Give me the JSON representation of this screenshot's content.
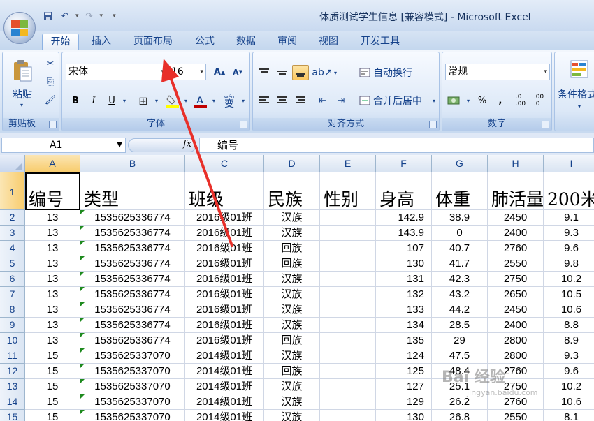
{
  "window": {
    "title": "体质测试学生信息  [兼容模式] - Microsoft Excel"
  },
  "tabs": [
    {
      "label": "开始",
      "active": true
    },
    {
      "label": "插入"
    },
    {
      "label": "页面布局"
    },
    {
      "label": "公式"
    },
    {
      "label": "数据"
    },
    {
      "label": "审阅"
    },
    {
      "label": "视图"
    },
    {
      "label": "开发工具"
    }
  ],
  "ribbon": {
    "clipboard": {
      "paste_label": "粘贴",
      "group_label": "剪贴板"
    },
    "font": {
      "font_name": "宋体",
      "font_size": "16",
      "bold": "B",
      "italic": "I",
      "underline": "U",
      "group_label": "字体",
      "phonetic": "wén"
    },
    "alignment": {
      "wrap_label": "自动换行",
      "merge_label": "合并后居中",
      "group_label": "对齐方式"
    },
    "number": {
      "format": "常规",
      "percent": "%",
      "comma": ",",
      "group_label": "数字"
    },
    "styles": {
      "conditional_label": "条件格式"
    }
  },
  "formula_bar": {
    "name_box": "A1",
    "fx": "fx",
    "content": "编号"
  },
  "grid": {
    "columns": [
      "A",
      "B",
      "C",
      "D",
      "E",
      "F",
      "G",
      "H",
      "I"
    ],
    "row_numbers": [
      "1",
      "2",
      "3",
      "4",
      "5",
      "6",
      "7",
      "8",
      "9",
      "10",
      "11",
      "12",
      "13",
      "14",
      "15"
    ],
    "headers": [
      "编号",
      "类型",
      "班级",
      "民族",
      "性别",
      "身高",
      "体重",
      "肺活量",
      "200米"
    ],
    "rows": [
      [
        "13",
        "1535625336774",
        "2016级01班",
        "汉族",
        "",
        "142.9",
        "38.9",
        "2450",
        "9.1"
      ],
      [
        "13",
        "1535625336774",
        "2016级01班",
        "汉族",
        "",
        "143.9",
        "0",
        "2400",
        "9.3"
      ],
      [
        "13",
        "1535625336774",
        "2016级01班",
        "回族",
        "",
        "107",
        "40.7",
        "2760",
        "9.6"
      ],
      [
        "13",
        "1535625336774",
        "2016级01班",
        "回族",
        "",
        "130",
        "41.7",
        "2550",
        "9.8"
      ],
      [
        "13",
        "1535625336774",
        "2016级01班",
        "汉族",
        "",
        "131",
        "42.3",
        "2750",
        "10.2"
      ],
      [
        "13",
        "1535625336774",
        "2016级01班",
        "汉族",
        "",
        "132",
        "43.2",
        "2650",
        "10.5"
      ],
      [
        "13",
        "1535625336774",
        "2016级01班",
        "汉族",
        "",
        "133",
        "44.2",
        "2450",
        "10.6"
      ],
      [
        "13",
        "1535625336774",
        "2016级01班",
        "汉族",
        "",
        "134",
        "28.5",
        "2400",
        "8.8"
      ],
      [
        "13",
        "1535625336774",
        "2016级01班",
        "回族",
        "",
        "135",
        "29",
        "2800",
        "8.9"
      ],
      [
        "15",
        "1535625337070",
        "2014级01班",
        "汉族",
        "",
        "124",
        "47.5",
        "2800",
        "9.3"
      ],
      [
        "15",
        "1535625337070",
        "2014级01班",
        "回族",
        "",
        "125",
        "48.4",
        "2760",
        "9.6"
      ],
      [
        "15",
        "1535625337070",
        "2014级01班",
        "汉族",
        "",
        "127",
        "25.1",
        "2750",
        "10.2"
      ],
      [
        "15",
        "1535625337070",
        "2014级01班",
        "汉族",
        "",
        "129",
        "26.2",
        "2760",
        "10.6"
      ],
      [
        "15",
        "1535625337070",
        "2014级01班",
        "汉族",
        "",
        "130",
        "26.8",
        "2550",
        "8.1"
      ]
    ]
  },
  "watermark": {
    "brand": "Bai 经验",
    "url": "jingyan.baidu.com"
  },
  "colors": {
    "annotation_arrow": "#e8302a",
    "ribbon_bg": "#dbe6f5",
    "accent": "#15428b"
  }
}
